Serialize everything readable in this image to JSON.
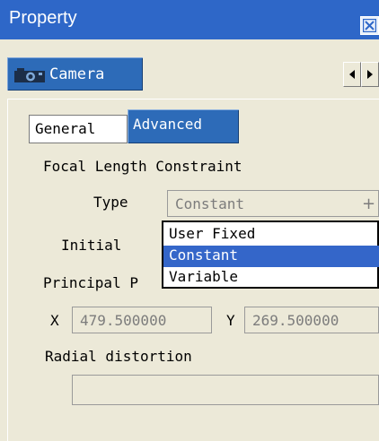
{
  "window": {
    "title": "Property"
  },
  "tabs": {
    "camera_label": "Camera"
  },
  "subtabs": {
    "general": "General",
    "advanced": "Advanced"
  },
  "focal": {
    "section_label": "Focal Length Constraint",
    "type_label": "Type",
    "type_value": "Constant",
    "initial_label": "Initial",
    "options": [
      "User Fixed",
      "Constant",
      "Variable"
    ],
    "selected_option": "Constant"
  },
  "principal": {
    "section_label": "Principal P",
    "x_label": "X",
    "x_value": "479.500000",
    "y_label": "Y",
    "y_value": "269.500000"
  },
  "radial": {
    "section_label": "Radial distortion",
    "value": ""
  },
  "colors": {
    "titlebar": "#2E67C8",
    "tab_active": "#2D6BB8",
    "selection": "#3466C9",
    "panel_bg": "#ECE9D8"
  }
}
